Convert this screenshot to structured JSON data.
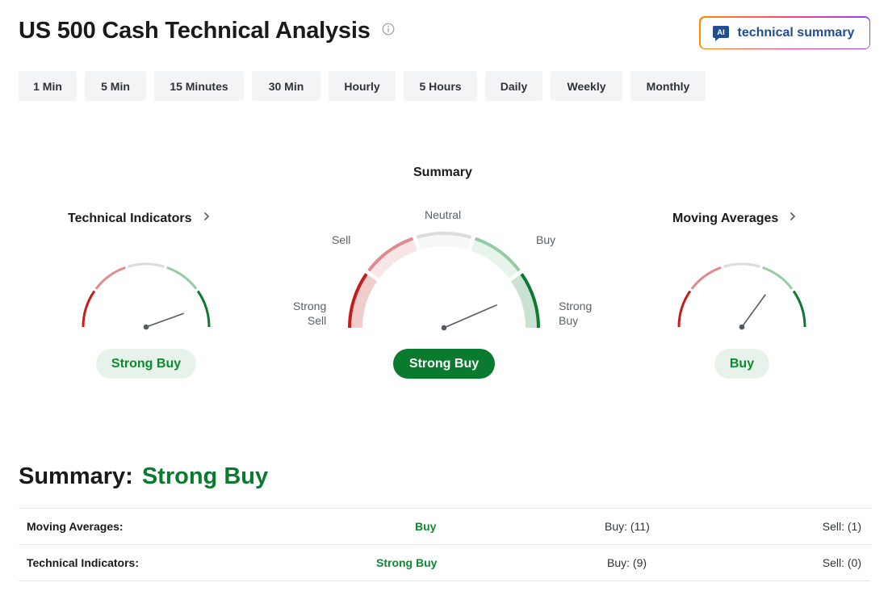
{
  "header": {
    "title": "US 500 Cash Technical Analysis",
    "ai_button_badge": "AI",
    "ai_button_label": "technical summary"
  },
  "tabs": [
    {
      "label": "1 Min",
      "active": false
    },
    {
      "label": "5 Min",
      "active": false
    },
    {
      "label": "15 Minutes",
      "active": false
    },
    {
      "label": "30 Min",
      "active": false
    },
    {
      "label": "Hourly",
      "active": false
    },
    {
      "label": "5 Hours",
      "active": true
    },
    {
      "label": "Daily",
      "active": false
    },
    {
      "label": "Weekly",
      "active": false
    },
    {
      "label": "Monthly",
      "active": false
    }
  ],
  "gauges": {
    "technical_indicators": {
      "title": "Technical Indicators",
      "result": "Strong Buy",
      "needle_value": 0.89
    },
    "summary": {
      "title": "Summary",
      "result": "Strong Buy",
      "needle_value": 0.87,
      "labels": {
        "neutral": "Neutral",
        "sell": "Sell",
        "buy": "Buy",
        "strong_sell": "Strong\nSell",
        "strong_buy": "Strong\nBuy"
      }
    },
    "moving_averages": {
      "title": "Moving Averages",
      "result": "Buy",
      "needle_value": 0.7
    }
  },
  "colors": {
    "strong_sell": "#c51c1c",
    "sell": "#e08b8b",
    "neutral": "#dcdcdc",
    "buy": "#93cca2",
    "strong_buy": "#0d7a30",
    "needle": "#555b62"
  },
  "summary": {
    "label": "Summary:",
    "value": "Strong Buy",
    "rows": [
      {
        "name": "Moving Averages:",
        "status": "Buy",
        "buy": "Buy: (11)",
        "sell": "Sell: (1)"
      },
      {
        "name": "Technical Indicators:",
        "status": "Strong Buy",
        "buy": "Buy: (9)",
        "sell": "Sell: (0)"
      }
    ]
  }
}
